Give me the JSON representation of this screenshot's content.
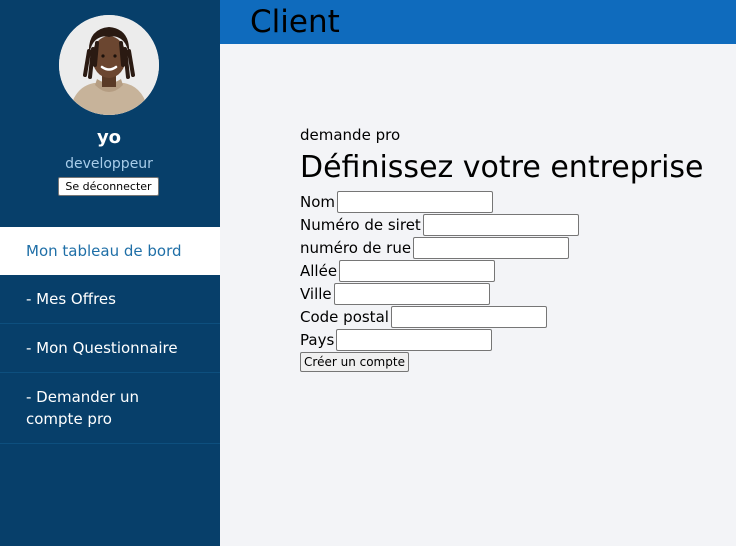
{
  "header": {
    "title": "Client"
  },
  "profile": {
    "name": "yo",
    "role": "developpeur",
    "logout_label": "Se déconnecter"
  },
  "nav": {
    "items": [
      {
        "label": "Mon tableau de bord",
        "active": true
      },
      {
        "label": "- Mes Offres"
      },
      {
        "label": "- Mon Questionnaire"
      },
      {
        "label": "- Demander un compte pro"
      }
    ]
  },
  "form": {
    "kicker": "demande pro",
    "title": "Définissez votre entreprise",
    "fields": [
      {
        "label": "Nom",
        "value": ""
      },
      {
        "label": "Numéro de siret",
        "value": ""
      },
      {
        "label": "numéro de rue",
        "value": ""
      },
      {
        "label": "Allée",
        "value": ""
      },
      {
        "label": "Ville",
        "value": ""
      },
      {
        "label": "Code postal",
        "value": ""
      },
      {
        "label": "Pays",
        "value": ""
      }
    ],
    "submit_label": "Créer un compte"
  }
}
